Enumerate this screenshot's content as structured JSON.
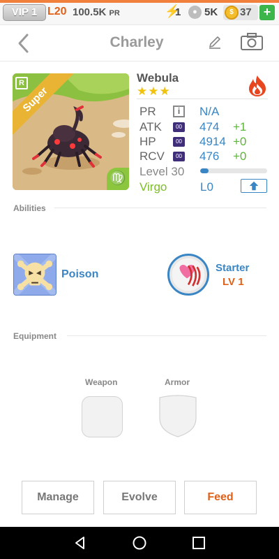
{
  "status_bar": {
    "vip": "VIP 1",
    "level": "L20",
    "power_value": "100.5K",
    "power_unit": "PR",
    "energy": "1",
    "paws": "5K",
    "coins": "37",
    "add_label": "+"
  },
  "nav": {
    "title": "Charley"
  },
  "pet": {
    "rarity_letter": "R",
    "rarity_ribbon": "Super",
    "species": "Webula",
    "stars": "★★★",
    "stats": [
      {
        "label": "PR",
        "icon": "i",
        "value": "N/A",
        "bonus": ""
      },
      {
        "label": "ATK",
        "icon": "00",
        "value": "474",
        "bonus": "+1"
      },
      {
        "label": "HP",
        "icon": "00",
        "value": "4914",
        "bonus": "+0"
      },
      {
        "label": "RCV",
        "icon": "00",
        "value": "476",
        "bonus": "+0"
      }
    ],
    "level_label": "Level 30",
    "level_progress": 0.12,
    "zodiac": "Virgo",
    "zodiac_glyph": "♍",
    "evolve_level": "L0"
  },
  "sections": {
    "abilities": "Abilities",
    "equipment": "Equipment"
  },
  "abilities": {
    "poison_label": "Poison",
    "starter_label": "Starter",
    "starter_level": "LV 1"
  },
  "equipment": {
    "weapon_label": "Weapon",
    "armor_label": "Armor"
  },
  "actions": {
    "manage": "Manage",
    "evolve": "Evolve",
    "feed": "Feed"
  },
  "colors": {
    "accent_blue": "#3a86c5",
    "accent_orange": "#e0611a",
    "bonus_green": "#5cb536",
    "zodiac_green": "#7dbd2a",
    "star_gold": "#f0c20d"
  },
  "icons": [
    "back-chevron-icon",
    "edit-pencil-icon",
    "camera-icon",
    "fire-element-icon",
    "skull-crossbones-icon",
    "heart-claw-icon",
    "shield-icon",
    "info-icon",
    "upgrade-arrow-icon"
  ]
}
